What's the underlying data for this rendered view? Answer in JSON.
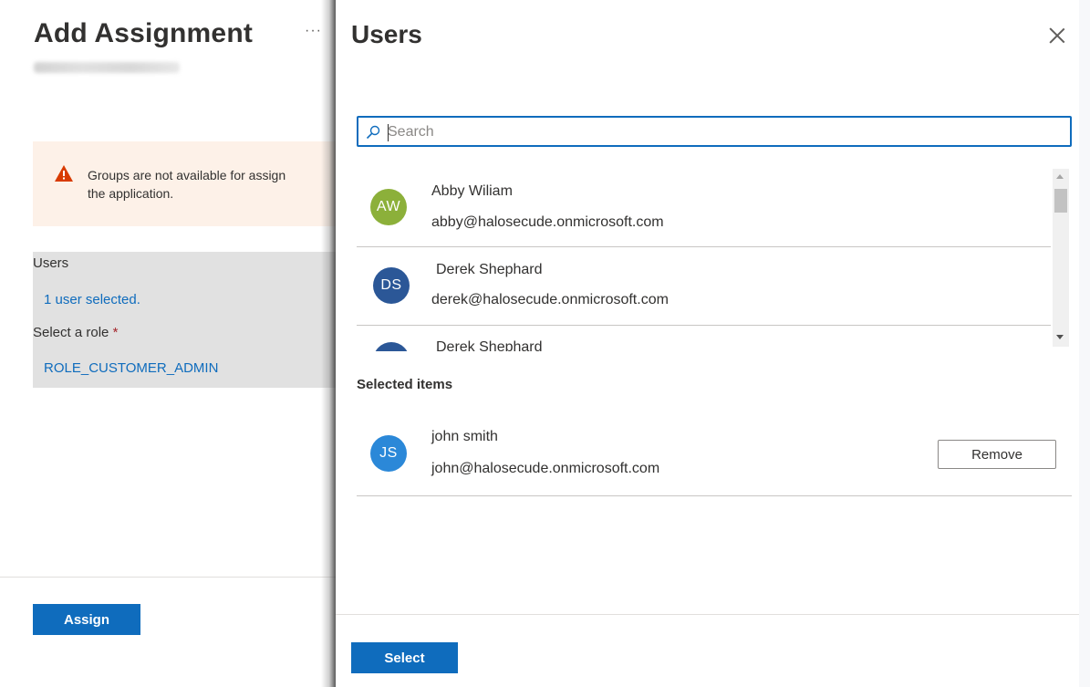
{
  "background_blade": {
    "title": "Add Assignment",
    "more_label": "···",
    "warning_text": "Groups are not available for assign\nthe application.",
    "users_label": "Users",
    "users_selected_link": "1 user selected.",
    "role_label": "Select a role",
    "required_mark": "*",
    "role_value": "ROLE_CUSTOMER_ADMIN",
    "assign_label": "Assign"
  },
  "users_panel": {
    "title": "Users",
    "search": {
      "placeholder": "Search",
      "value": ""
    },
    "users": [
      {
        "initials": "AW",
        "name": "Abby Wiliam",
        "email": "abby@halosecude.onmicrosoft.com",
        "avatar_color": "#8cb03a"
      },
      {
        "initials": "DS",
        "name": "Derek Shephard",
        "email": "derek@halosecude.onmicrosoft.com",
        "avatar_color": "#2b5797"
      },
      {
        "initials": "",
        "name": "Derek Shephard",
        "email": "",
        "avatar_color": "#2b5797"
      }
    ],
    "selected_heading": "Selected items",
    "selected_items": [
      {
        "initials": "JS",
        "name": "john smith",
        "email": "john@halosecude.onmicrosoft.com",
        "avatar_color": "#2b88d8",
        "remove_label": "Remove"
      }
    ],
    "select_label": "Select"
  },
  "colors": {
    "accent": "#0f6cbd",
    "warning_bg": "#fdf1e8",
    "warning_icon": "#d83b01"
  }
}
